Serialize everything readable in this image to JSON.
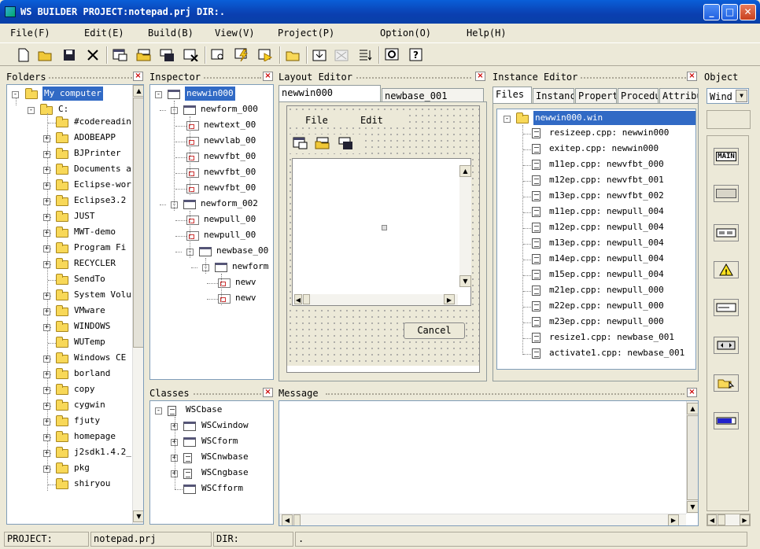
{
  "window": {
    "title": "WS BUILDER PROJECT:notepad.prj DIR:."
  },
  "menu": [
    "File(F)",
    "Edit(E)",
    "Build(B)",
    "View(V)",
    "Project(P)",
    "Option(O)",
    "Help(H)"
  ],
  "toolbar": [
    "new-icon",
    "open-icon",
    "save-icon",
    "cut-icon",
    "new-form-icon",
    "open-form-icon",
    "save-form-icon",
    "close-form-icon",
    "inspect-icon",
    "build-icon",
    "run-icon",
    "folder-icon",
    "download-icon",
    "grid-icon",
    "list-icon",
    "preview-icon",
    "help-icon"
  ],
  "folders": {
    "title": "Folders",
    "root": "My computer",
    "drive": "C:",
    "items": [
      "#codereadin",
      "ADOBEAPP",
      "BJPrinter",
      "Documents a",
      "Eclipse-wor",
      "Eclipse3.2",
      "JUST",
      "MWT-demo",
      "Program Fi",
      "RECYCLER",
      "SendTo",
      "System Volu",
      "VMware",
      "WINDOWS",
      "WUTemp",
      "Windows CE",
      "borland",
      "copy",
      "cygwin",
      "fjuty",
      "homepage",
      "j2sdk1.4.2_",
      "pkg",
      "shiryou"
    ]
  },
  "inspector": {
    "title": "Inspector",
    "items": [
      "newwin000",
      "newform_000",
      "newtext_00",
      "newvlab_00",
      "newvfbt_00",
      "newvfbt_00",
      "newvfbt_00",
      "newform_002",
      "newpull_00",
      "newpull_00",
      "newbase_00",
      "newform",
      "newv",
      "newv"
    ]
  },
  "layout": {
    "title": "Layout Editor",
    "tabs": [
      "newwin000",
      "newbase_001"
    ],
    "form_menu": [
      "File",
      "Edit"
    ],
    "cancel": "Cancel"
  },
  "instance": {
    "title": "Instance Editor",
    "tabs": [
      "Files",
      "Instanc",
      "Propert",
      "Procedu",
      "Attribu"
    ],
    "root": "newwin000.win",
    "files": [
      "resizeep.cpp: newwin000",
      "exitep.cpp: newwin000",
      "m11ep.cpp: newvfbt_000",
      "m12ep.cpp: newvfbt_001",
      "m13ep.cpp: newvfbt_002",
      "m11ep.cpp: newpull_004",
      "m12ep.cpp: newpull_004",
      "m13ep.cpp: newpull_004",
      "m14ep.cpp: newpull_004",
      "m15ep.cpp: newpull_004",
      "m21ep.cpp: newpull_000",
      "m22ep.cpp: newpull_000",
      "m23ep.cpp: newpull_000",
      "resize1.cpp: newbase_001",
      "activate1.cpp: newbase_001"
    ]
  },
  "object": {
    "title": "Object",
    "select": "Wind",
    "buttons": [
      "MAIN"
    ]
  },
  "classes": {
    "title": "Classes",
    "items": [
      "WSCbase",
      "WSCwindow",
      "WSCform",
      "WSCnwbase",
      "WSCngbase",
      "WSCfform"
    ]
  },
  "message": {
    "title": "Message"
  },
  "status": {
    "project_label": "PROJECT:",
    "project": "notepad.prj",
    "dir_label": "DIR:",
    "dir": "."
  }
}
